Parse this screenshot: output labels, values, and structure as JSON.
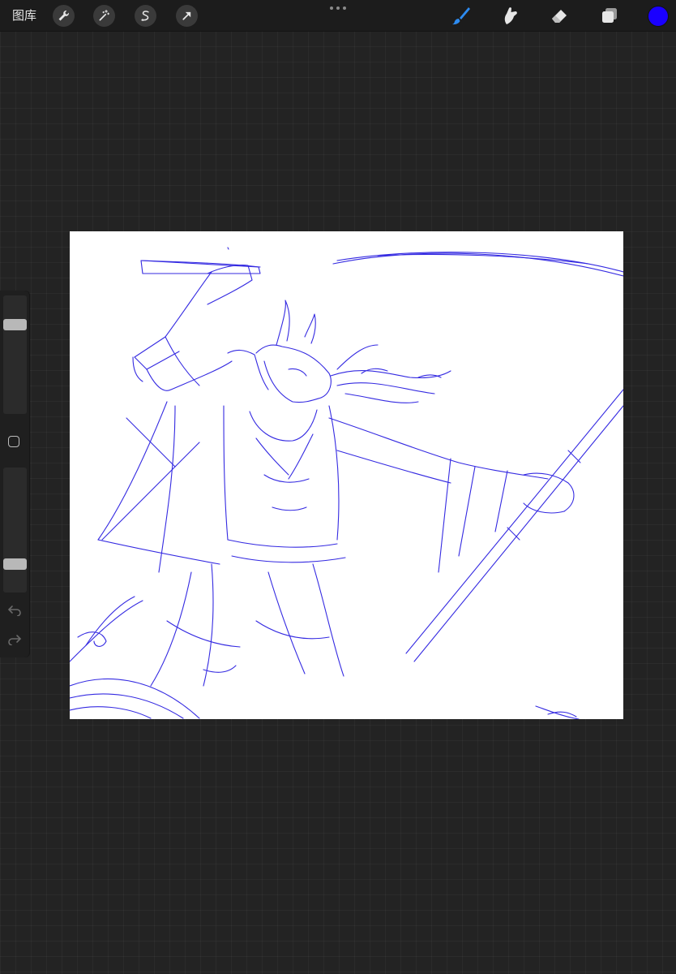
{
  "topbar": {
    "gallery_label": "图库",
    "left_tools": [
      {
        "name": "wrench-icon"
      },
      {
        "name": "magic-wand-icon"
      },
      {
        "name": "selection-s-icon"
      },
      {
        "name": "transform-arrow-icon"
      }
    ],
    "right_tools": [
      {
        "name": "brush-icon",
        "active": true
      },
      {
        "name": "smudge-icon",
        "active": false
      },
      {
        "name": "eraser-icon",
        "active": false
      },
      {
        "name": "layers-icon",
        "active": false
      }
    ],
    "current_color": "#1a00ff",
    "active_tool_color": "#2d8bf0"
  },
  "sidebar": {
    "brush_size_level": 0.78,
    "opacity_level": 0.2,
    "undo_icon": "undo-icon",
    "redo_icon": "redo-icon"
  },
  "canvas": {
    "stroke_color": "#2a1fe0",
    "background": "#ffffff"
  }
}
